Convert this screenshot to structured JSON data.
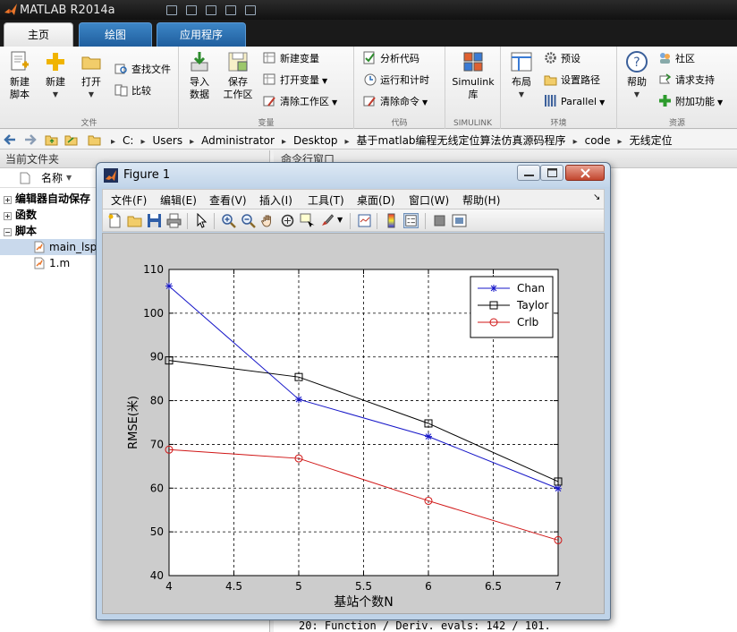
{
  "app": {
    "title": "MATLAB R2014a"
  },
  "ribbon": {
    "tabs": [
      {
        "label": "主页"
      },
      {
        "label": "绘图"
      },
      {
        "label": "应用程序"
      }
    ],
    "file_group": {
      "label": "文件",
      "new_script": "新建\n脚本",
      "new": "新建",
      "open": "打开",
      "find_files": "查找文件",
      "compare": "比较"
    },
    "variable_group": {
      "label": "变量",
      "import": "导入\n数据",
      "save_ws": "保存\n工作区",
      "new_var": "新建变量",
      "open_var": "打开变量",
      "clear_ws": "清除工作区"
    },
    "code_group": {
      "label": "代码",
      "analyze": "分析代码",
      "run_time": "运行和计时",
      "clear_cmd": "清除命令"
    },
    "simulink_group": {
      "label": "SIMULINK",
      "lib": "Simulink\n库"
    },
    "env_group": {
      "label": "环境",
      "layout": "布局",
      "prefs": "预设",
      "set_path": "设置路径",
      "parallel": "Parallel"
    },
    "resources_group": {
      "label": "资源",
      "help": "帮助",
      "community": "社区",
      "support": "请求支持",
      "addons": "附加功能"
    }
  },
  "address": {
    "segments": [
      "C:",
      "Users",
      "Administrator",
      "Desktop",
      "基于matlab编程无线定位算法仿真源码程序",
      "code",
      "无线定位"
    ]
  },
  "file_panel": {
    "title": "当前文件夹",
    "col_name": "名称",
    "items": [
      {
        "label": "编辑器自动保存",
        "type": "folder",
        "expand": "+"
      },
      {
        "label": "函数",
        "type": "folder",
        "expand": "+"
      },
      {
        "label": "脚本",
        "type": "folder",
        "expand": "−"
      },
      {
        "label": "main_lsp",
        "type": "file",
        "selected": true
      },
      {
        "label": "1.m",
        "type": "file",
        "selected": false
      }
    ]
  },
  "command_panel": {
    "title": "命令行窗口",
    "last_line": "20: Function / Deriv. evals: 142 / 101."
  },
  "figure": {
    "title": "Figure 1",
    "menu": [
      "文件(F)",
      "编辑(E)",
      "查看(V)",
      "插入(I)",
      "工具(T)",
      "桌面(D)",
      "窗口(W)",
      "帮助(H)"
    ]
  },
  "chart_data": {
    "type": "line",
    "title": "",
    "xlabel": "基站个数N",
    "ylabel": "RMSE(米)",
    "xlim": [
      4,
      7
    ],
    "ylim": [
      40,
      110
    ],
    "xticks": [
      "4",
      "4.5",
      "5",
      "5.5",
      "6",
      "6.5",
      "7"
    ],
    "yticks": [
      "40",
      "50",
      "60",
      "70",
      "80",
      "90",
      "100",
      "110"
    ],
    "grid": true,
    "legend_position": "top-right",
    "x": [
      4,
      5,
      6,
      7
    ],
    "series": [
      {
        "name": "Chan",
        "marker": "star",
        "color": "#1515c8",
        "values": [
          106.2,
          80.3,
          71.8,
          59.9
        ]
      },
      {
        "name": "Taylor",
        "marker": "square",
        "color": "#000000",
        "values": [
          89.2,
          85.4,
          74.8,
          61.5
        ]
      },
      {
        "name": "Crlb",
        "marker": "circle",
        "color": "#d01515",
        "values": [
          68.8,
          66.8,
          57.1,
          48.1
        ]
      }
    ]
  }
}
